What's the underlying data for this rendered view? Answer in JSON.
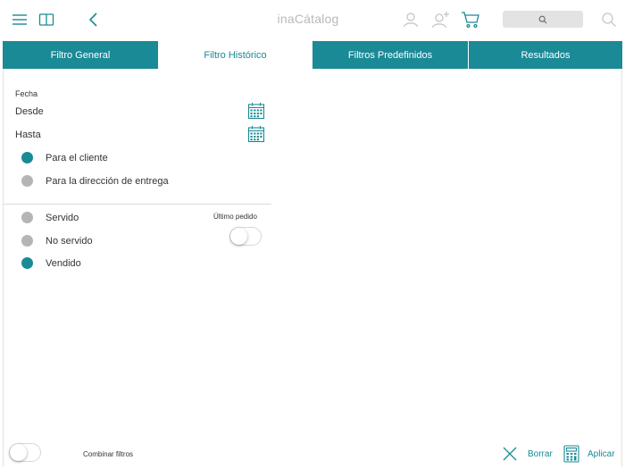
{
  "app": {
    "title": "inaCátalog"
  },
  "colors": {
    "accent": "#1a8a96",
    "inactive_radio": "#b5b5b5"
  },
  "tabs": [
    {
      "label": "Filtro General",
      "active": false
    },
    {
      "label": "Filtro Histórico",
      "active": true
    },
    {
      "label": "Filtros Predefinidos",
      "active": false
    },
    {
      "label": "Resultados",
      "active": false
    }
  ],
  "form": {
    "fecha_label": "Fecha",
    "desde_label": "Desde",
    "hasta_label": "Hasta",
    "scope_options": [
      {
        "label": "Para el cliente",
        "selected": true
      },
      {
        "label": "Para la dirección de entrega",
        "selected": false
      }
    ],
    "status_options": [
      {
        "label": "Servido",
        "selected": false
      },
      {
        "label": "No servido",
        "selected": false
      },
      {
        "label": "Vendido",
        "selected": true
      }
    ],
    "ultimo_pedido_label": "Último pedido",
    "ultimo_pedido_on": false
  },
  "footer": {
    "combinar_label": "Combinar filtros",
    "combinar_on": false,
    "borrar_label": "Borrar",
    "aplicar_label": "Aplicar"
  }
}
